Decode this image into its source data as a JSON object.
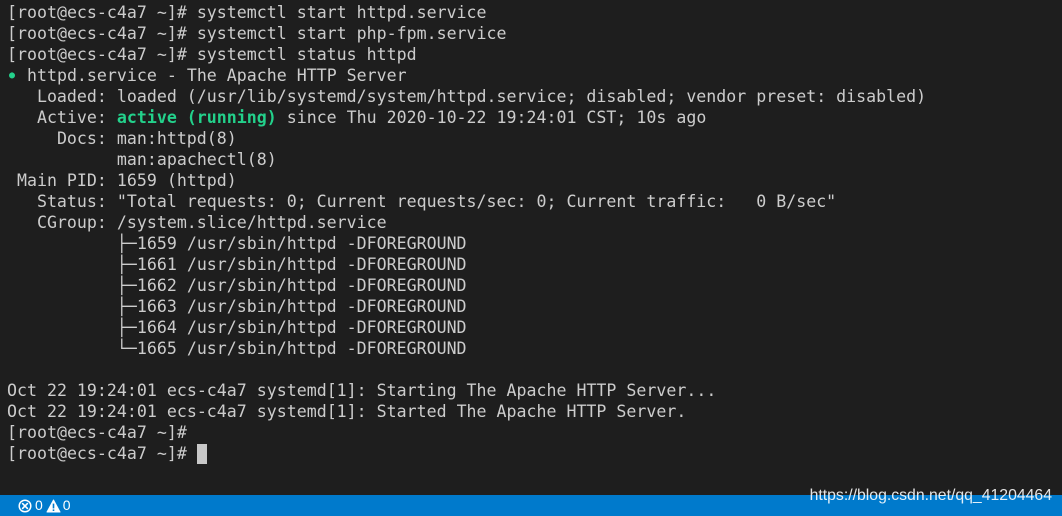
{
  "terminal": {
    "history": [
      {
        "prompt": "[root@ecs-c4a7 ~]#",
        "command": "systemctl start httpd.service"
      },
      {
        "prompt": "[root@ecs-c4a7 ~]#",
        "command": "systemctl start php-fpm.service"
      },
      {
        "prompt": "[root@ecs-c4a7 ~]#",
        "command": "systemctl status httpd"
      }
    ],
    "status_output": {
      "bullet": "●",
      "unit_line": "httpd.service - The Apache HTTP Server",
      "loaded": {
        "label": "Loaded:",
        "value": "loaded (/usr/lib/systemd/system/httpd.service; disabled; vendor preset: disabled)"
      },
      "active": {
        "label": "Active:",
        "state": "active (running)",
        "since": "since Thu 2020-10-22 19:24:01 CST; 10s ago"
      },
      "docs": {
        "label": "Docs:",
        "values": [
          "man:httpd(8)",
          "man:apachectl(8)"
        ]
      },
      "main_pid": {
        "label": "Main PID:",
        "value": "1659 (httpd)"
      },
      "status": {
        "label": "Status:",
        "value": "\"Total requests: 0; Current requests/sec: 0; Current traffic:   0 B/sec\""
      },
      "cgroup": {
        "label": "CGroup:",
        "value": "/system.slice/httpd.service",
        "processes": [
          "├─1659 /usr/sbin/httpd -DFOREGROUND",
          "├─1661 /usr/sbin/httpd -DFOREGROUND",
          "├─1662 /usr/sbin/httpd -DFOREGROUND",
          "├─1663 /usr/sbin/httpd -DFOREGROUND",
          "├─1664 /usr/sbin/httpd -DFOREGROUND",
          "└─1665 /usr/sbin/httpd -DFOREGROUND"
        ]
      }
    },
    "journal": [
      "Oct 22 19:24:01 ecs-c4a7 systemd[1]: Starting The Apache HTTP Server...",
      "Oct 22 19:24:01 ecs-c4a7 systemd[1]: Started The Apache HTTP Server."
    ],
    "trailing_prompts": [
      "[root@ecs-c4a7 ~]#",
      "[root@ecs-c4a7 ~]#"
    ],
    "colors": {
      "background": "#1e1e1e",
      "foreground": "#cccccc",
      "active_green": "#23d18b"
    }
  },
  "status_bar": {
    "errors_icon": "error-circle-icon",
    "errors_count": "0",
    "warnings_icon": "warning-triangle-icon",
    "warnings_count": "0",
    "background": "#007acc"
  },
  "watermark": {
    "text": "https://blog.csdn.net/qq_41204464"
  }
}
